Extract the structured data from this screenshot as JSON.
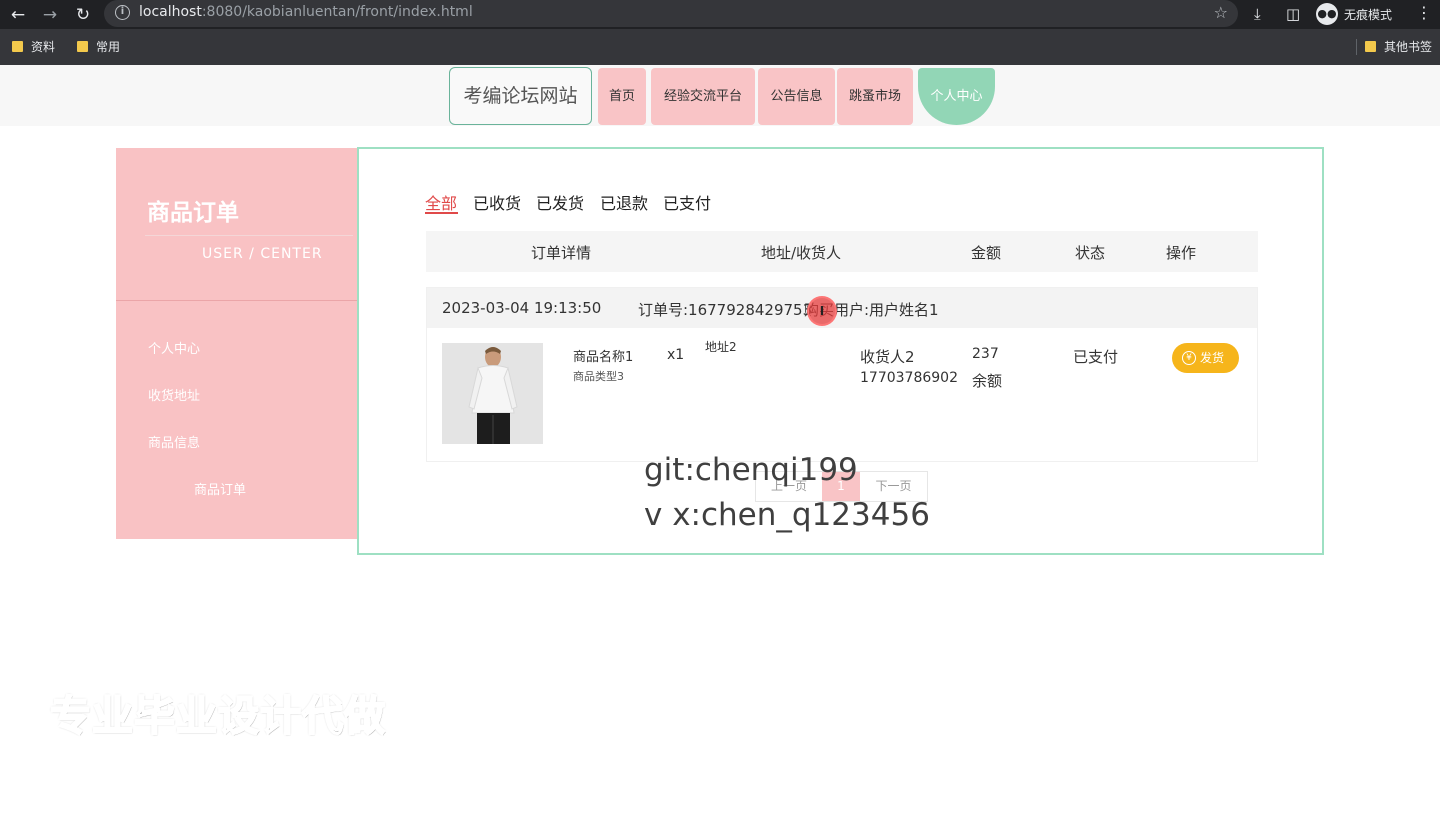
{
  "browser": {
    "url_host": "localhost",
    "url_rest": ":8080/kaobianluentan/front/index.html",
    "incognito_label": "无痕模式",
    "bookmarks": [
      "资料",
      "常用"
    ],
    "other_bookmarks": "其他书签"
  },
  "site": {
    "logo": "考编论坛网站",
    "nav": [
      "首页",
      "经验交流平台",
      "公告信息",
      "跳蚤市场",
      "个人中心"
    ],
    "active_nav": "个人中心"
  },
  "sidebar": {
    "title": "商品订单",
    "subtitle": "USER / CENTER",
    "items": [
      "个人中心",
      "收货地址",
      "商品信息",
      "商品订单"
    ]
  },
  "tabs": [
    "全部",
    "已收货",
    "已发货",
    "已退款",
    "已支付"
  ],
  "active_tab": "全部",
  "table": {
    "headers": [
      "订单详情",
      "地址/收货人",
      "金额",
      "状态",
      "操作"
    ]
  },
  "order": {
    "time": "2023-03-04 19:13:50",
    "order_no_label": "订单号:1677928429753",
    "buyer": "购买用户:用户姓名1",
    "cursor_glyph": "I",
    "product_name": "商品名称1",
    "product_type": "商品类型3",
    "quantity": "x1",
    "address": "地址2",
    "receiver": "收货人2",
    "phone": "17703786902",
    "amount": "237",
    "pay_method": "余额",
    "status": "已支付",
    "action": "发货",
    "action_icon": "yen-icon"
  },
  "pager": {
    "prev": "上一页",
    "current": "1",
    "next": "下一页"
  },
  "watermark": {
    "line1": "git:chenqi199",
    "line2": "v x:chen_q123456",
    "line3": "专业毕业设计代做"
  }
}
